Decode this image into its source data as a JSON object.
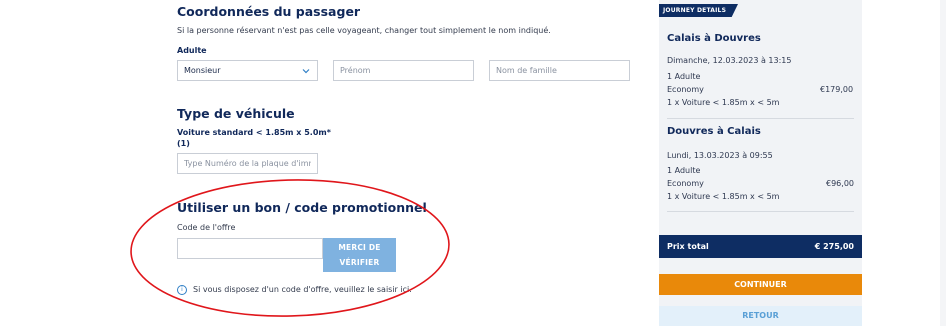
{
  "passenger": {
    "title": "Coordonnées du passager",
    "note": "Si la personne réservant n'est pas celle voyageant, changer tout simplement le nom indiqué.",
    "adult_label": "Adulte",
    "salutation_value": "Monsieur",
    "firstname_placeholder": "Prénom",
    "lastname_placeholder": "Nom de famille"
  },
  "vehicle": {
    "title": "Type de véhicule",
    "label_line1": "Voiture standard < 1.85m x 5.0m*",
    "label_line2": "(1)",
    "plate_placeholder": "Type Numéro de la plaque d'imm"
  },
  "promo": {
    "title": "Utiliser un bon / code promotionnel",
    "code_label": "Code de l'offre",
    "button_line1": "MERCI DE",
    "button_line2": "VÉRIFIER",
    "info_text": "Si vous disposez d'un code d'offre, veuillez le saisir ici.",
    "info_icon": "i"
  },
  "journey": {
    "tag": "JOURNEY DETAILS",
    "outbound": {
      "route": "Calais à Douvres",
      "datetime": "Dimanche, 12.03.2023 à 13:15",
      "passengers": "1 Adulte",
      "class": "Economy",
      "price": "€179,00",
      "vehicle": "1 x Voiture < 1.85m x < 5m"
    },
    "return": {
      "route": "Douvres à Calais",
      "datetime": "Lundi, 13.03.2023 à 09:55",
      "passengers": "1 Adulte",
      "class": "Economy",
      "price": "€96,00",
      "vehicle": "1 x Voiture < 1.85m x < 5m"
    },
    "total_label": "Prix total",
    "total_value": "€ 275,00",
    "continue_label": "CONTINUER",
    "back_label": "RETOUR"
  },
  "colors": {
    "navy": "#0e2d63",
    "orange": "#e9890a",
    "light_blue_button": "#7fb2e0",
    "annotation_red": "#e0161b"
  }
}
